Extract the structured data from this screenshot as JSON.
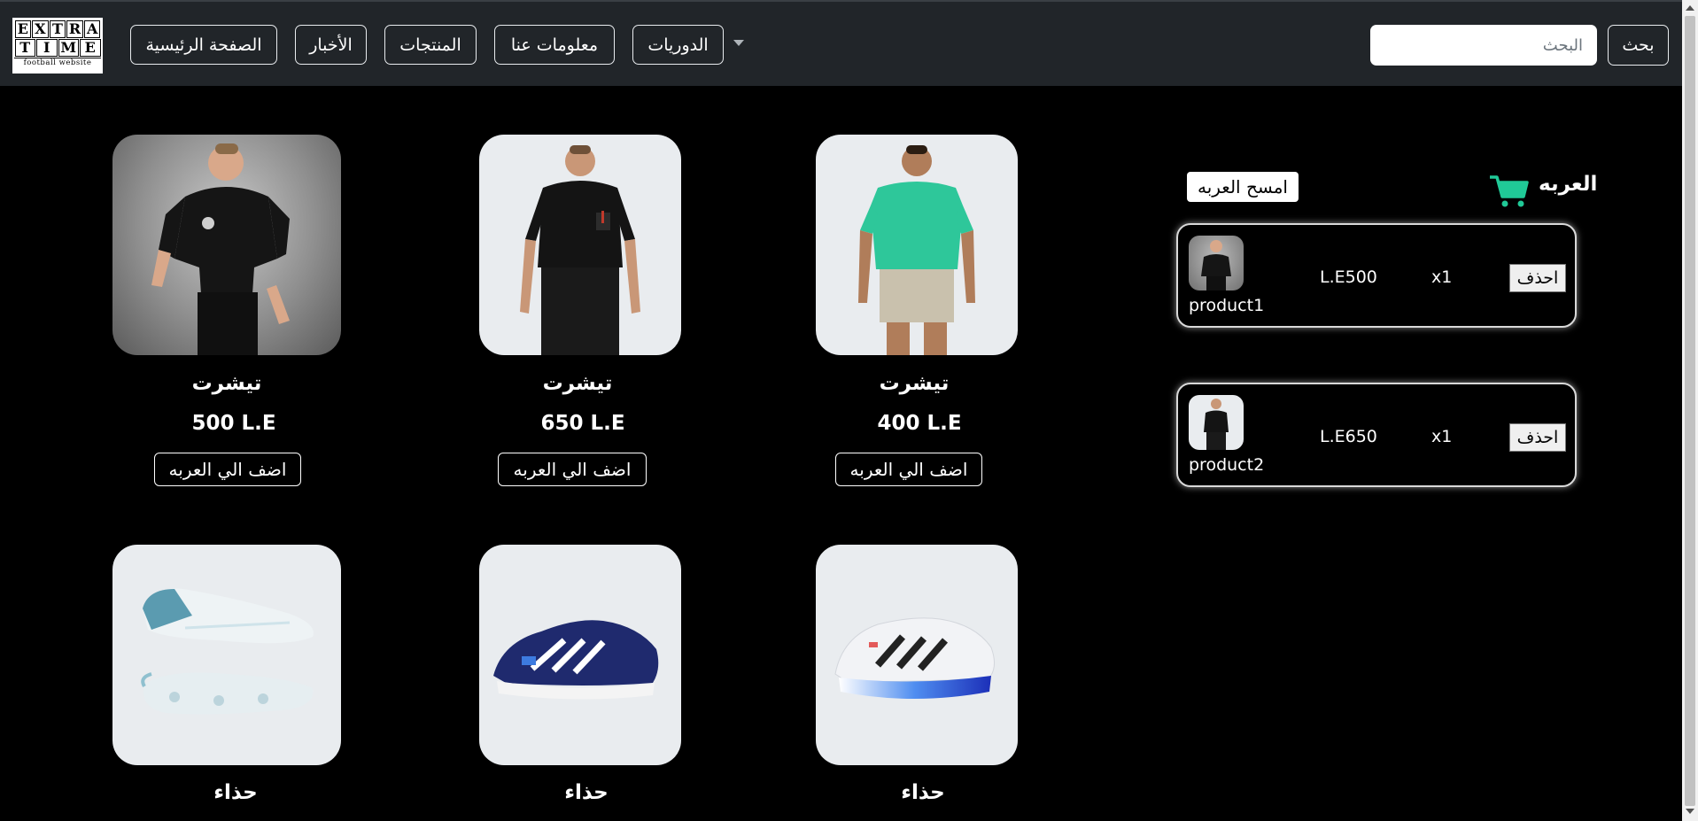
{
  "nav": {
    "logo": {
      "line1": [
        "E",
        "X",
        "T",
        "R",
        "A"
      ],
      "line2": [
        "T",
        "I",
        "M",
        "E"
      ],
      "tagline": "football website"
    },
    "home": "الصفحة الرئيسية",
    "news": "الأخبار",
    "products": "المنتجات",
    "about": "معلومات عنا",
    "leagues": "الدوريات",
    "search_placeholder": "البحث",
    "search_button": "بحث"
  },
  "products": [
    {
      "name": "تيشرت",
      "price": "500 L.E",
      "button": "اضف الي العربه",
      "icon": "tshirt-black-model-image"
    },
    {
      "name": "تيشرت",
      "price": "650 L.E",
      "button": "اضف الي العربه",
      "icon": "tshirt-black-pocket-image"
    },
    {
      "name": "تيشرت",
      "price": "400 L.E",
      "button": "اضف الي العربه",
      "icon": "tshirt-green-image"
    },
    {
      "name": "حذاء",
      "icon": "football-boots-image"
    },
    {
      "name": "حذاء",
      "icon": "running-shoe-navy-image"
    },
    {
      "name": "حذاء",
      "icon": "running-shoe-white-image"
    }
  ],
  "cart": {
    "title": "العربه",
    "clear_button": "امسح العربه",
    "accent_color": "#20c997",
    "items": [
      {
        "label": "product1",
        "price": "L.E500",
        "qty": "x1",
        "delete": "احذف"
      },
      {
        "label": "product2",
        "price": "L.E650",
        "qty": "x1",
        "delete": "احذف"
      }
    ]
  }
}
